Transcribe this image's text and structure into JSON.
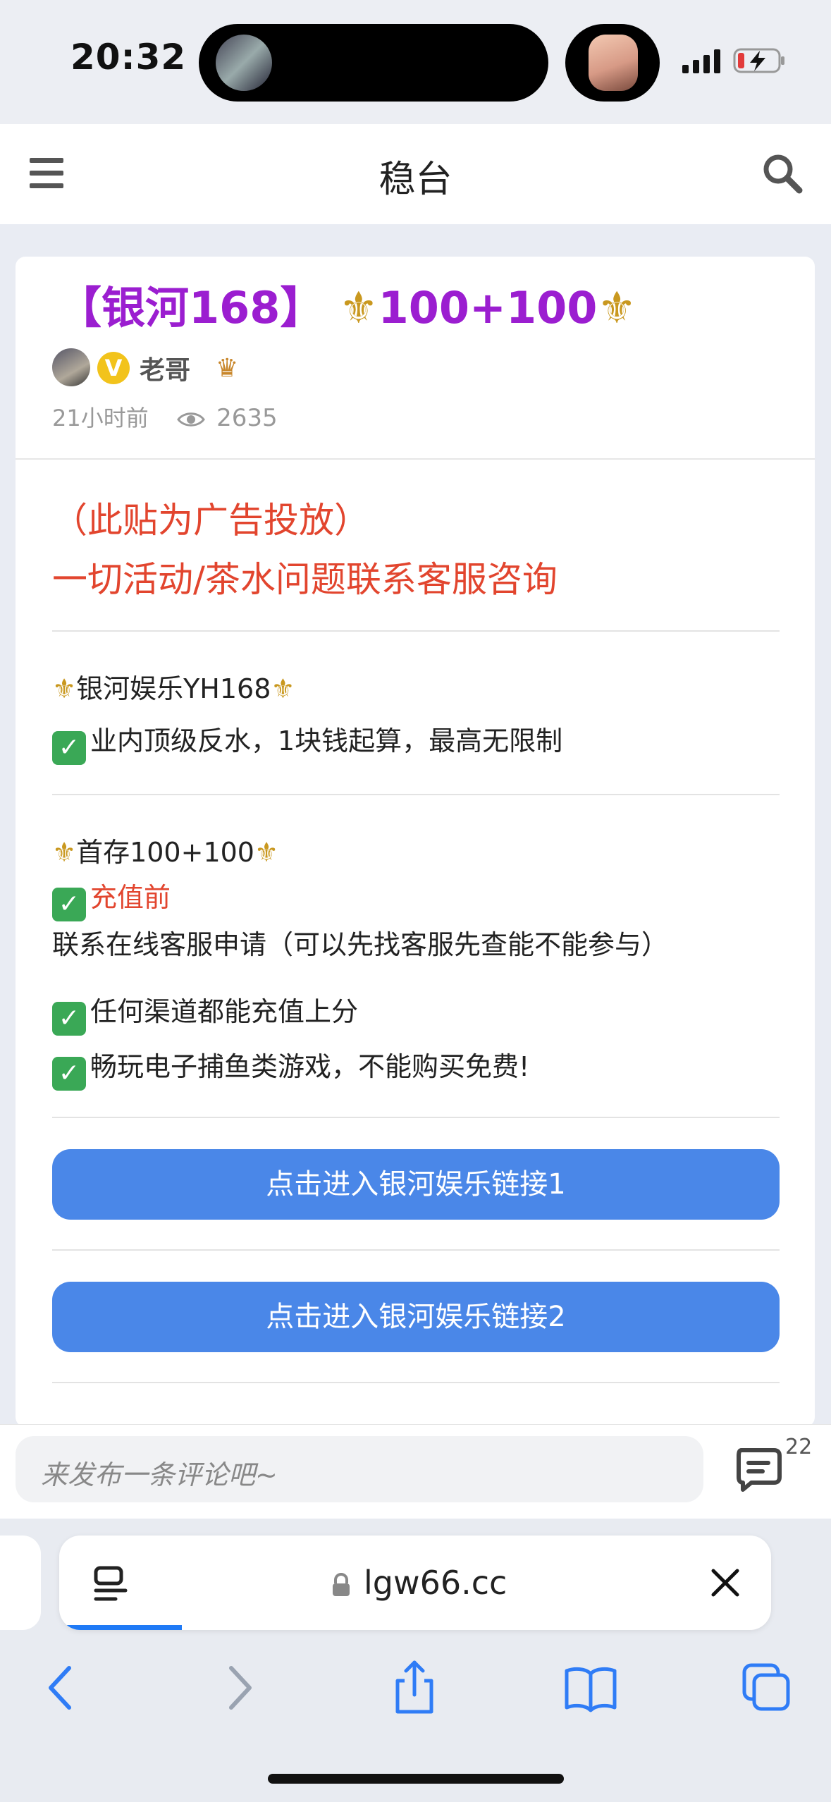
{
  "status": {
    "time": "20:32"
  },
  "header": {
    "title": "稳台"
  },
  "post": {
    "title_left": "【银河168】",
    "title_mid": "100+100",
    "fleur_glyph": "⚜",
    "author": {
      "badge": "V",
      "name": "老哥"
    },
    "meta": {
      "time": "21小时前",
      "views": "2635"
    },
    "notice_line1": "（此贴为广告投放）",
    "notice_line2": "一切活动/茶水问题联系客服咨询",
    "section1": {
      "heading": "银河娱乐YH168",
      "item1": "业内顶级反水，1块钱起算，最高无限制"
    },
    "section2": {
      "heading": "首存100+100",
      "item1_highlight": "充值前",
      "item1_rest": "联系在线客服申请（可以先找客服先查能不能参与）",
      "item2": "任何渠道都能充值上分",
      "item3": "畅玩电子捕鱼类游戏，不能购买免费!"
    },
    "link1": "点击进入银河娱乐链接1",
    "link2": "点击进入银河娱乐链接2"
  },
  "comment": {
    "placeholder": "来发布一条评论吧~",
    "count": "22"
  },
  "browser": {
    "url": "lgw66.cc"
  },
  "colors": {
    "title": "#9b1ed0",
    "red": "#e2452e",
    "button": "#4a87e8",
    "check": "#3aa856",
    "fleur": "#c9981f"
  }
}
